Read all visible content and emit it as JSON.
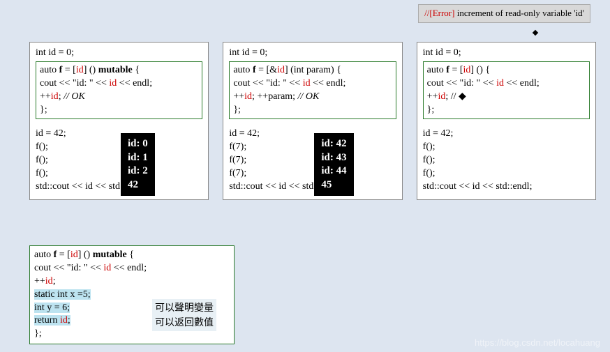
{
  "error_note": {
    "prefix": "//[Error]",
    "text": " increment of read-only variable 'id'"
  },
  "p1": {
    "line1": "int id = 0;",
    "box_l1a": "auto ",
    "box_l1b": "f",
    "box_l1c": " = [",
    "box_l1d": "id",
    "box_l1e": "] () ",
    "box_l1f": "mutable",
    "box_l1g": " {",
    "box_l2a": "    cout << \"id: \" << ",
    "box_l2b": "id",
    "box_l2c": " << endl;",
    "box_l3a": "    ++",
    "box_l3b": "id",
    "box_l3c": "; ",
    "box_l3d": "// OK",
    "box_l4": "};",
    "after1": "id = 42;",
    "after2": "f();",
    "after3": "f();",
    "after4": "f();",
    "after5": "std::cout << id << std::endl;",
    "out1": "id: 0",
    "out2": "id: 1",
    "out3": "id: 2",
    "out4": "42"
  },
  "p2": {
    "line1": "int id = 0;",
    "box_l1a": "auto ",
    "box_l1b": "f",
    "box_l1c": " = [&",
    "box_l1d": "id",
    "box_l1e": "] (int param) {",
    "box_l2a": "    cout << \"id: \" << ",
    "box_l2b": "id",
    "box_l2c": " << endl;",
    "box_l3a": "    ++",
    "box_l3b": "id",
    "box_l3c": "; ++param; ",
    "box_l3d": "// OK",
    "box_l4": "};",
    "after1": "id = 42;",
    "after2": "f(7);",
    "after3": "f(7);",
    "after4": "f(7);",
    "after5": "std::cout << id << std::endl;",
    "out1": "id: 42",
    "out2": "id: 43",
    "out3": "id: 44",
    "out4": "45"
  },
  "p3": {
    "line1": "int id = 0;",
    "box_l1a": "auto ",
    "box_l1b": "f",
    "box_l1c": " = [",
    "box_l1d": "id",
    "box_l1e": "] () {",
    "box_l2a": "    cout << \"id: \" << ",
    "box_l2b": "id",
    "box_l2c": " << endl;",
    "box_l3a": "    ++",
    "box_l3b": "id",
    "box_l3c": "; // ◆",
    "box_l4": "};",
    "after1": "id = 42;",
    "after2": "f();",
    "after3": "f();",
    "after4": "f();",
    "after5": "std::cout << id << std::endl;"
  },
  "p4": {
    "l1a": "auto ",
    "l1b": "f",
    "l1c": " = [",
    "l1d": "id",
    "l1e": "] () ",
    "l1f": "mutable",
    "l1g": " {",
    "l2a": "    cout << \"id: \" << ",
    "l2b": "id",
    "l2c": " << endl;",
    "l3a": "    ++",
    "l3b": "id",
    "l3c": ";",
    "l4": "    static int x =5;",
    "l5": "    int y = 6;",
    "l6a": "    return ",
    "l6b": "id",
    "l6c": ";",
    "l7": "};",
    "note1": "可以聲明變量",
    "note2": "可以返回數值"
  },
  "watermark": "https://blog.csdn.net/locahuang"
}
